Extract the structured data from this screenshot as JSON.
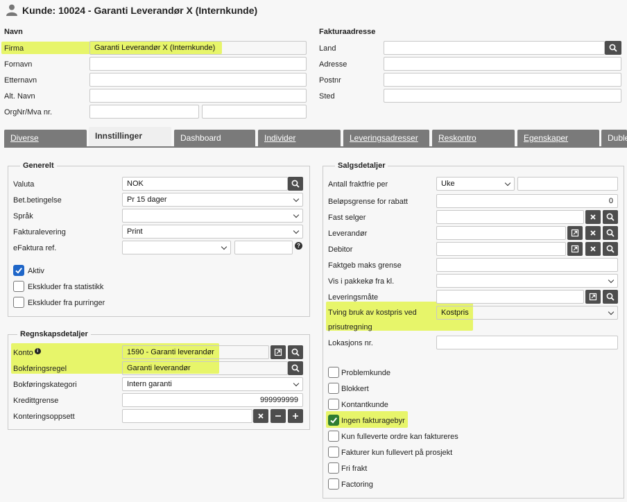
{
  "header": {
    "title": "Kunde: 10024 - Garanti Leverandør X (Internkunde)",
    "user_icon": "user-icon"
  },
  "navn": {
    "heading": "Navn",
    "firma_label": "Firma",
    "firma_value": "Garanti Leverandør X (Internkunde)",
    "fornavn_label": "Fornavn",
    "etternavn_label": "Etternavn",
    "alt_navn_label": "Alt. Navn",
    "orgnr_label": "OrgNr/Mva nr."
  },
  "fakturaadresse": {
    "heading": "Fakturaadresse",
    "land_label": "Land",
    "adresse_label": "Adresse",
    "postnr_label": "Postnr",
    "sted_label": "Sted"
  },
  "tabs": [
    "Diverse",
    "Innstillinger",
    "Dashboard",
    "Individer",
    "Leveringsadresser",
    "Reskontro",
    "Egenskaper",
    "Duble"
  ],
  "generelt": {
    "heading": "Generelt",
    "valuta_label": "Valuta",
    "valuta_value": "NOK",
    "bet_label": "Bet.betingelse",
    "bet_value": "Pr 15 dager",
    "sprak_label": "Språk",
    "fakturalevering_label": "Fakturalevering",
    "fakturalevering_value": "Print",
    "efaktura_label": "eFaktura ref.",
    "aktiv_label": "Aktiv",
    "ekskl_stat_label": "Ekskluder fra statistikk",
    "ekskl_purr_label": "Ekskluder fra purringer"
  },
  "regnskap": {
    "heading": "Regnskapsdetaljer",
    "konto_label": "Konto",
    "konto_value": "1590 - Garanti leverandør",
    "bokfregel_label": "Bokføringsregel",
    "bokfregel_value": "Garanti leverandør",
    "bokfkat_label": "Bokføringskategori",
    "bokfkat_value": "Intern garanti",
    "kreditt_label": "Kredittgrense",
    "kreditt_value": "999999999",
    "kontering_label": "Konteringsoppsett"
  },
  "salg": {
    "heading": "Salgsdetaljer",
    "fraktfrie_label": "Antall fraktfrie per",
    "fraktfrie_unit": "Uke",
    "belopsgrense_label": "Beløpsgrense for rabatt",
    "belopsgrense_value": "0",
    "fast_selger_label": "Fast selger",
    "leverandor_label": "Leverandør",
    "debitor_label": "Debitor",
    "faktgeb_label": "Faktgeb maks grense",
    "pakkeko_label": "Vis i pakkekø fra kl.",
    "leveringsmate_label": "Leveringsmåte",
    "kostpris_label_1": "Tving bruk av kostpris ved",
    "kostpris_label_2": "prisutregning",
    "kostpris_value": "Kostpris",
    "lokasjon_label": "Lokasjons nr.",
    "checks": [
      "Problemkunde",
      "Blokkert",
      "Kontantkunde",
      "Ingen fakturagebyr",
      "Kun fulleverte ordre kan faktureres",
      "Fakturer kun fullevert på prosjekt",
      "Fri frakt",
      "Factoring"
    ],
    "checked": [
      false,
      false,
      false,
      true,
      false,
      false,
      false,
      false
    ]
  },
  "highlight_color": "#e7f56a"
}
